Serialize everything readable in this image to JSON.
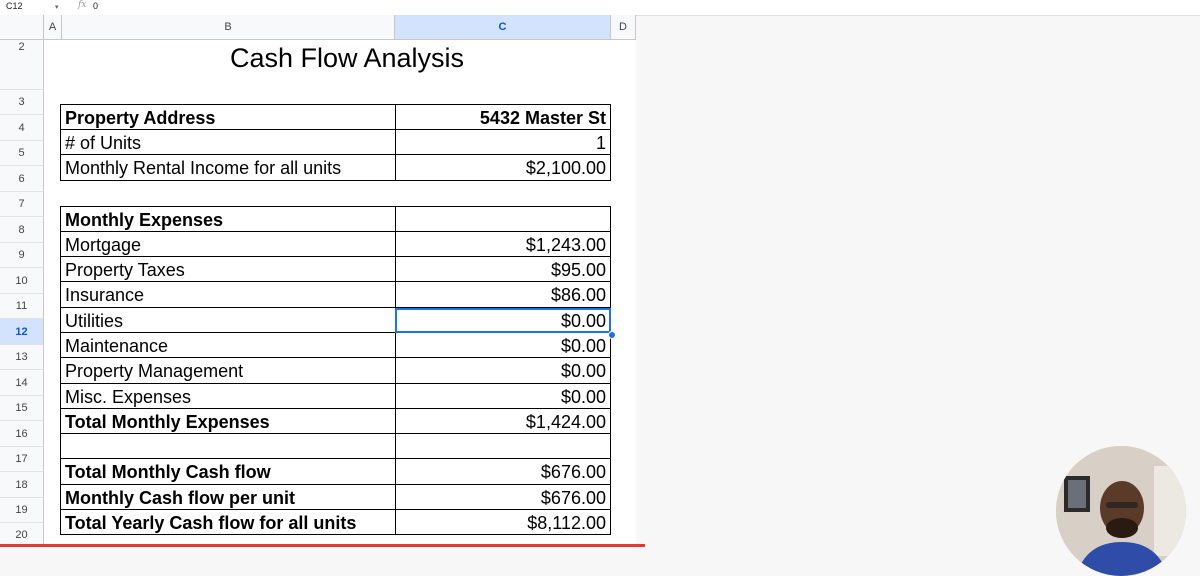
{
  "formula_bar": {
    "cell_ref": "C12",
    "fx": "fx",
    "value": "0"
  },
  "columns": [
    "A",
    "B",
    "C",
    "D"
  ],
  "rows": [
    "2",
    "3",
    "4",
    "5",
    "6",
    "7",
    "8",
    "9",
    "10",
    "11",
    "12",
    "13",
    "14",
    "15",
    "16",
    "17",
    "18",
    "19",
    "20"
  ],
  "selected_row": "12",
  "title": "Cash Flow Analysis",
  "property": [
    {
      "label": "Property Address",
      "value": "5432 Master St"
    },
    {
      "label": "# of Units",
      "value": "1"
    },
    {
      "label": "Monthly Rental Income for all units",
      "value": "$2,100.00"
    }
  ],
  "expenses_header": "Monthly Expenses",
  "expenses": [
    {
      "label": "Mortgage",
      "value": "$1,243.00"
    },
    {
      "label": "Property Taxes",
      "value": "$95.00"
    },
    {
      "label": "Insurance",
      "value": "$86.00"
    },
    {
      "label": "Utilities",
      "value": "$0.00"
    },
    {
      "label": "Maintenance",
      "value": "$0.00"
    },
    {
      "label": "Property Management",
      "value": "$0.00"
    },
    {
      "label": "Misc. Expenses",
      "value": "$0.00"
    }
  ],
  "total_expenses": {
    "label": "Total Monthly Expenses",
    "value": "$1,424.00"
  },
  "cashflow": [
    {
      "label": "Total Monthly Cash flow",
      "value": "$676.00"
    },
    {
      "label": "Monthly Cash flow per unit",
      "value": "$676.00"
    },
    {
      "label": "Total Yearly Cash flow for all units",
      "value": "$8,112.00"
    }
  ],
  "colors": {
    "selection": "#1a73e8",
    "header_selected": "#d3e3fd",
    "progress": "#e53935"
  }
}
